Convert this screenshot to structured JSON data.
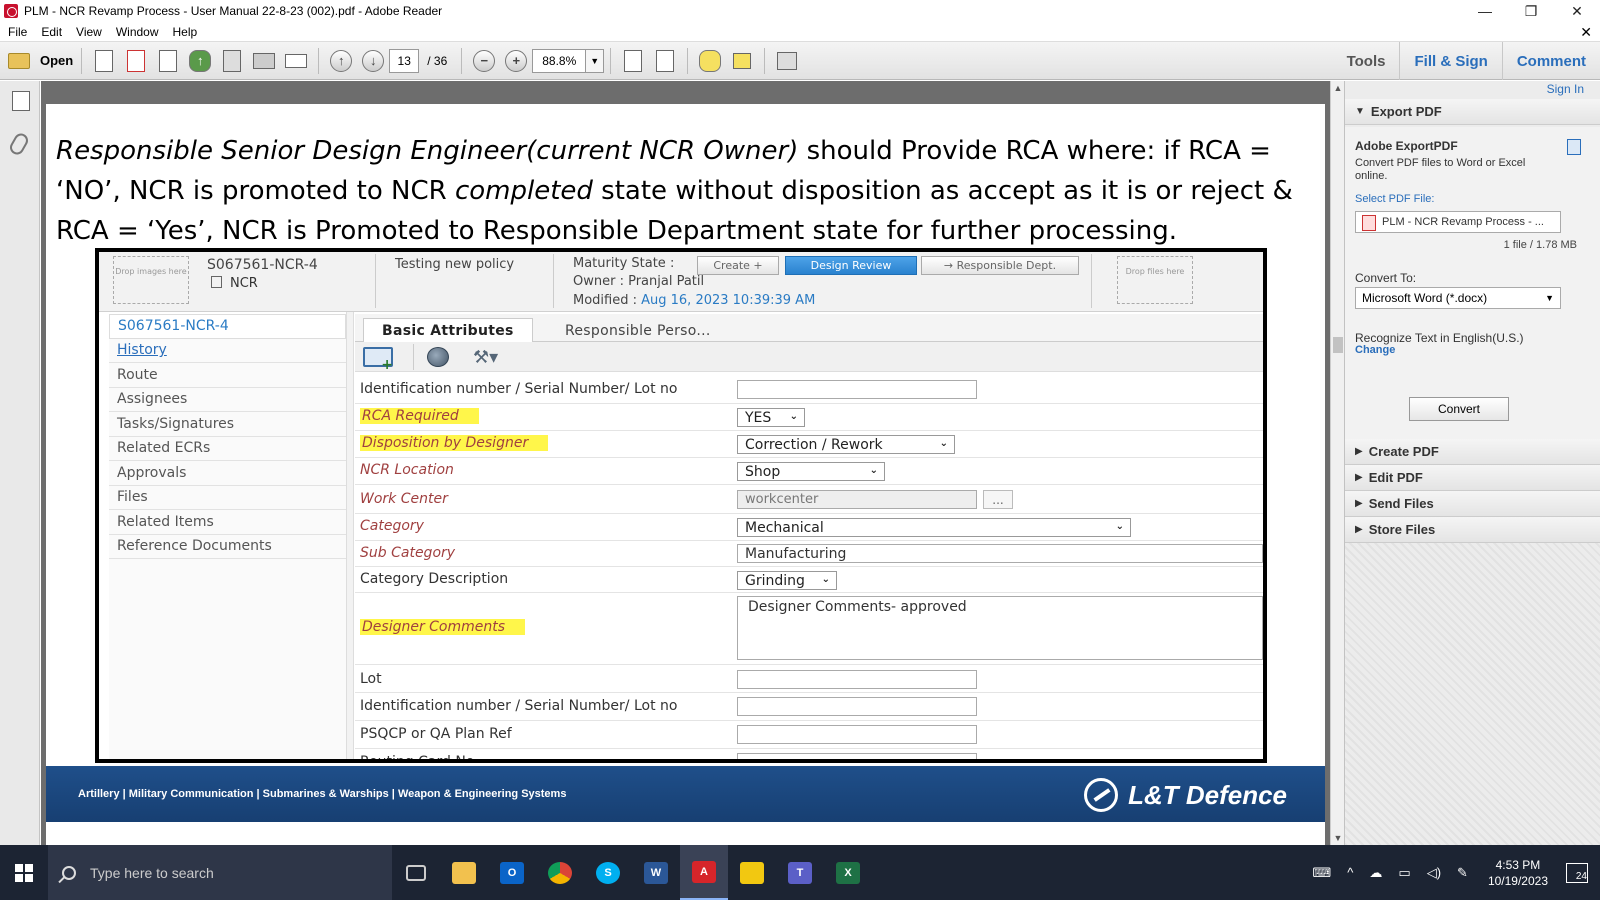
{
  "window": {
    "title": "PLM - NCR Revamp Process - User Manual 22-8-23 (002).pdf - Adobe Reader",
    "controls": [
      "—",
      "❐",
      "✕"
    ]
  },
  "menu": {
    "items": [
      "File",
      "Edit",
      "View",
      "Window",
      "Help"
    ],
    "close": "✕"
  },
  "toolbar": {
    "open_label": "Open",
    "page_current": "13",
    "page_total": "/ 36",
    "zoom": "88.8%",
    "tools": "Tools",
    "fill_sign": "Fill & Sign",
    "comment": "Comment"
  },
  "document": {
    "intro_em1": "Responsible Senior Design Engineer(current NCR Owner)",
    "intro_t1": " should Provide RCA where: if RCA = ‘NO’, NCR is promoted to NCR ",
    "intro_em2": "completed",
    "intro_t2": " state without disposition as accept as it is or reject & RCA = ‘Yes’, NCR is Promoted to Responsible Department state for further processing.",
    "footer_tagline": "Artillery | Military Communication | Submarines & Warships | Weapon & Engineering Systems",
    "footer_logo": "L&T Defence"
  },
  "ncr_screen": {
    "drop_images": "Drop images here",
    "drop_files": "Drop files here",
    "object_name": "S067561-NCR-4",
    "object_type": "NCR",
    "description": "Testing new policy",
    "maturity_label": "Maturity State :",
    "state_prev": "Create +",
    "state_current": "Design Review",
    "state_next": "→ Responsible Dept.",
    "owner_line": "Owner : Pranjal Patil",
    "modified_label": "Modified : ",
    "modified_value": "Aug 16, 2023 10:39:39 AM",
    "nav": [
      "S067561-NCR-4",
      "History",
      "Route",
      "Assignees",
      "Tasks/Signatures",
      "Related ECRs",
      "Approvals",
      "Files",
      "Related Items",
      "Reference Documents"
    ],
    "tab_basic": "Basic Attributes",
    "tab_resp": "Responsible Perso...",
    "fields": {
      "id_serial_1": {
        "label": "Identification number / Serial Number/ Lot no",
        "value": ""
      },
      "rca": {
        "label": "RCA Required",
        "value": "YES"
      },
      "disposition": {
        "label": "Disposition by Designer",
        "value": "Correction / Rework"
      },
      "location": {
        "label": "NCR Location",
        "value": "Shop"
      },
      "work_center": {
        "label": "Work Center",
        "value": "workcenter",
        "button": "..."
      },
      "category": {
        "label": "Category",
        "value": "Mechanical"
      },
      "sub_category": {
        "label": "Sub Category",
        "value": "Manufacturing"
      },
      "category_desc": {
        "label": "Category Description",
        "value": "Grinding"
      },
      "designer_comments": {
        "label": "Designer Comments",
        "value": "Designer Comments- approved"
      },
      "lot": {
        "label": "Lot",
        "value": ""
      },
      "id_serial_2": {
        "label": "Identification number / Serial Number/ Lot no",
        "value": ""
      },
      "psqcp": {
        "label": "PSQCP or QA Plan Ref",
        "value": ""
      },
      "routing": {
        "label": "Routing Card No",
        "value": ""
      }
    }
  },
  "right_pane": {
    "sign_in": "Sign In",
    "export_header": "Export PDF",
    "export_title": "Adobe ExportPDF",
    "export_desc": "Convert PDF files to Word or Excel online.",
    "select_label": "Select PDF File:",
    "file_name": "PLM - NCR Revamp Process - ...",
    "file_meta": "1 file / 1.78 MB",
    "convert_to_label": "Convert To:",
    "convert_to_value": "Microsoft Word (*.docx)",
    "ocr_label": "Recognize Text in English(U.S.)",
    "change_link": "Change",
    "convert_button": "Convert",
    "sections": [
      "Create PDF",
      "Edit PDF",
      "Send Files",
      "Store Files"
    ]
  },
  "taskbar": {
    "search_placeholder": "Type here to search",
    "time": "4:53 PM",
    "date": "10/19/2023",
    "notifications": "24"
  },
  "colors": {
    "accent": "#2a6ebb",
    "state_current": "#2a82cf",
    "highlight": "#fff64a",
    "footer": "#1f4f8a"
  }
}
